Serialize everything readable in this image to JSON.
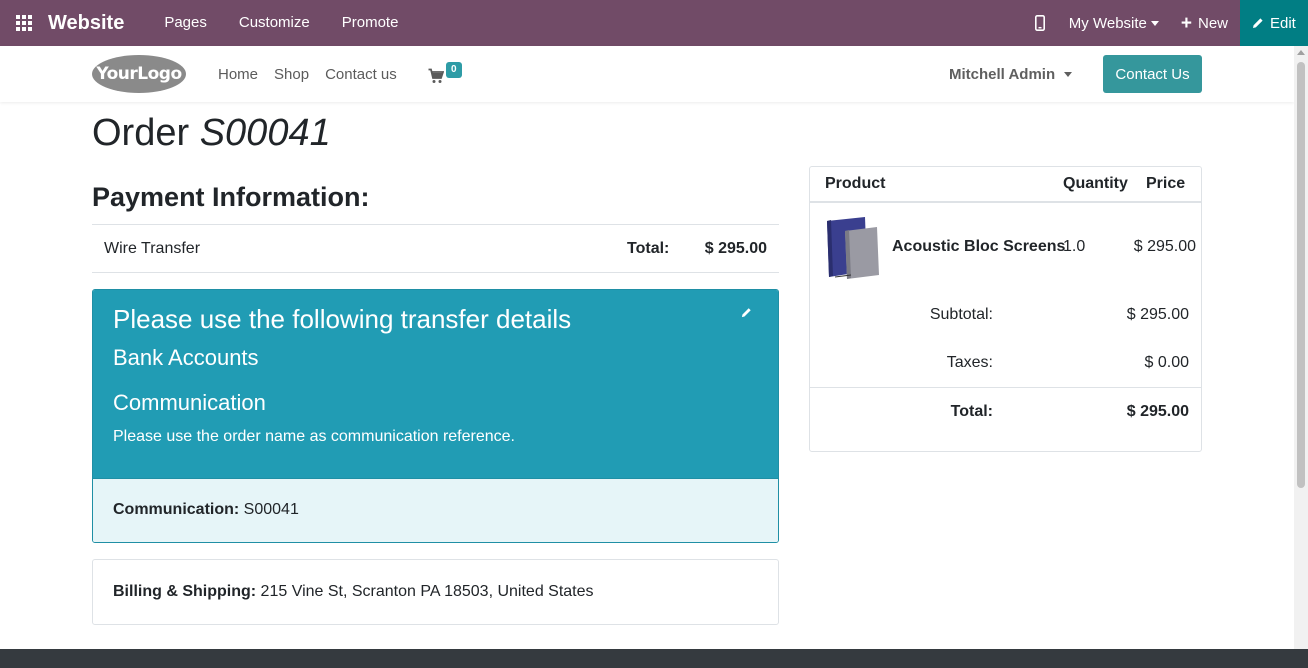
{
  "admin_bar": {
    "app_name": "Website",
    "menu": [
      "Pages",
      "Customize",
      "Promote"
    ],
    "site_switcher": "My Website",
    "new_label": "New",
    "edit_label": "Edit",
    "colors": {
      "background": "#714b67",
      "edit_background": "#017e84"
    }
  },
  "site_nav": {
    "logo_text": "YourLogo",
    "links": [
      "Home",
      "Shop",
      "Contact us"
    ],
    "cart_count": "0",
    "user_name": "Mitchell Admin",
    "contact_button": "Contact Us"
  },
  "order": {
    "title_prefix": "Order",
    "number": "S00041"
  },
  "payment": {
    "heading": "Payment Information:",
    "method": "Wire Transfer",
    "total_label": "Total:",
    "total_value": "$ 295.00"
  },
  "transfer": {
    "title": "Please use the following transfer details",
    "bank_accounts": "Bank Accounts",
    "communication_heading": "Communication",
    "note": "Please use the order name as communication reference.",
    "communication_label": "Communication:",
    "communication_value": "S00041",
    "colors": {
      "header": "#219cb4",
      "footer": "#e6f5f8"
    }
  },
  "billing": {
    "label": "Billing & Shipping:",
    "address": "215 Vine St, Scranton PA 18503, United States"
  },
  "summary": {
    "columns": [
      "Product",
      "Quantity",
      "Price"
    ],
    "items": [
      {
        "name": "Acoustic Bloc Screens",
        "quantity": "1.0",
        "price": "$ 295.00"
      }
    ],
    "subtotal_label": "Subtotal:",
    "subtotal_value": "$ 295.00",
    "taxes_label": "Taxes:",
    "taxes_value": "$ 0.00",
    "total_label": "Total:",
    "total_value": "$ 295.00"
  }
}
